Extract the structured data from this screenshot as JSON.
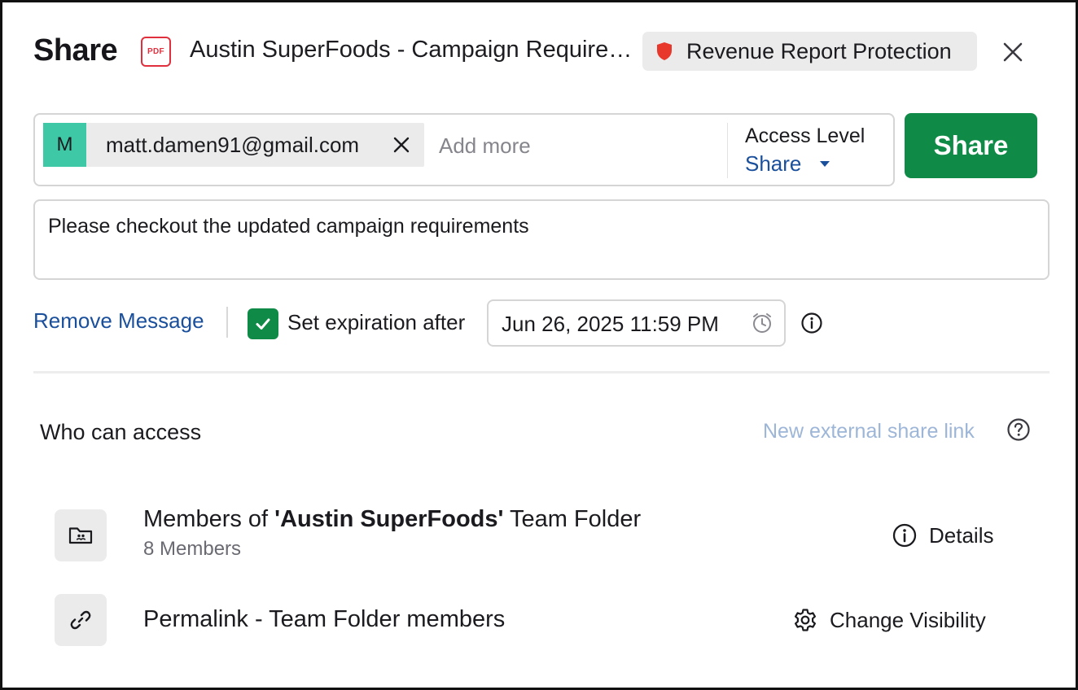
{
  "header": {
    "title": "Share",
    "file_icon_text": "PDF",
    "file_name": "Austin SuperFoods - Campaign Requirements",
    "protection_badge": "Revenue Report Protection"
  },
  "recipients": {
    "chips": [
      {
        "avatar_initial": "M",
        "email": "matt.damen91@gmail.com"
      }
    ],
    "add_more_placeholder": "Add more",
    "access_level_label": "Access Level",
    "access_level_value": "Share"
  },
  "share_button_label": "Share",
  "message": {
    "text": "Please checkout the updated campaign requirements"
  },
  "options": {
    "remove_message_label": "Remove Message",
    "expiration_checked": true,
    "expiration_label": "Set expiration after",
    "expiration_date": "Jun 26, 2025 11:59 PM"
  },
  "access": {
    "title": "Who can access",
    "new_link_label": "New external share link",
    "rows": [
      {
        "title_prefix": "Members of ",
        "title_bold": "'Austin SuperFoods'",
        "title_suffix": " Team Folder",
        "subtitle": "8 Members",
        "action_label": "Details"
      },
      {
        "title": "Permalink - Team Folder members",
        "action_label": "Change Visibility"
      }
    ]
  },
  "colors": {
    "primary_green": "#0f8a47",
    "link_blue": "#1a4f9c",
    "muted_link": "#9db6d8",
    "avatar_teal": "#3ec8a6",
    "shield_red": "#e8382c",
    "pdf_red": "#e0303d"
  },
  "icons": {
    "pdf": "pdf-file-icon",
    "shield": "shield-icon",
    "close": "close-icon",
    "chip_remove": "remove-chip-icon",
    "caret": "caret-down-icon",
    "check": "checkmark-icon",
    "clock": "alarm-clock-icon",
    "info": "info-icon",
    "help": "question-icon",
    "team_folder": "team-folder-icon",
    "link": "link-icon",
    "gear": "gear-icon"
  }
}
